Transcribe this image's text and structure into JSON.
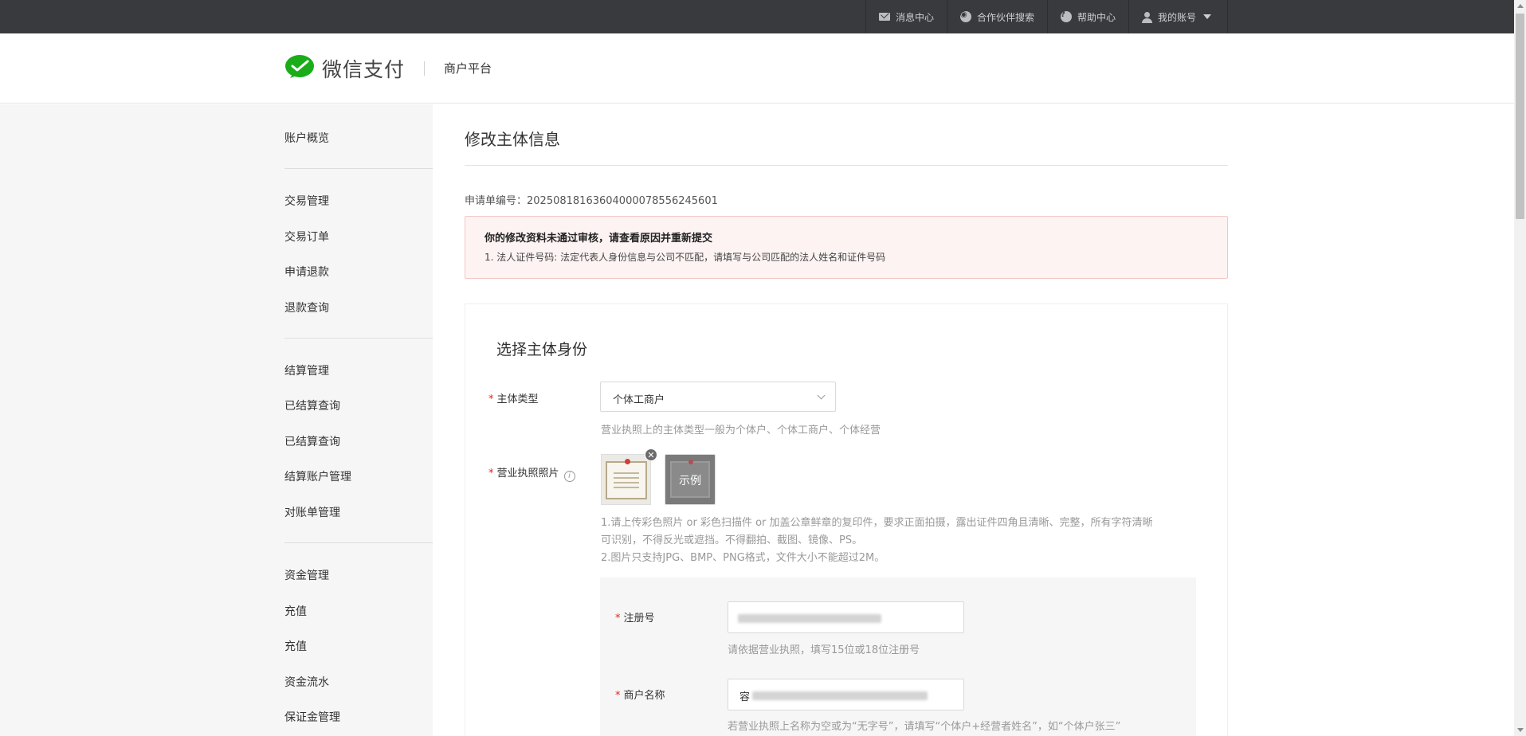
{
  "topbar": {
    "items": [
      {
        "label": "消息中心",
        "icon": "mail-icon"
      },
      {
        "label": "合作伙伴搜索",
        "icon": "partner-search-icon"
      },
      {
        "label": "帮助中心",
        "icon": "help-icon"
      },
      {
        "label": "我的账号",
        "icon": "user-icon"
      }
    ],
    "background": "#393a3e"
  },
  "header": {
    "brand": "微信支付",
    "platform": "商户平台",
    "brand_color": "#09bb07"
  },
  "sidebar": {
    "groups": [
      [
        "账户概览"
      ],
      [
        "交易管理",
        "交易订单",
        "申请退款",
        "退款查询"
      ],
      [
        "结算管理",
        "已结算查询",
        "已结算查询",
        "结算账户管理",
        "对账单管理"
      ],
      [
        "资金管理",
        "充值",
        "充值",
        "资金流水",
        "保证金管理"
      ]
    ]
  },
  "main": {
    "title": "修改主体信息",
    "application_label": "申请单编号：",
    "application_no": "2025081816360400007855624560​1",
    "alert": {
      "title": "你的修改资料未通过审核，请查看原因并重新提交",
      "message": "1. 法人证件号码: 法定代表人身份信息与公司不匹配，请填写与公司匹配的法人姓名和证件号码"
    },
    "section_title": "选择主体身份",
    "entity_type": {
      "label": "主体类型",
      "value": "个体工商户",
      "hint": "营业执照上的主体类型一般为个体户、个体工商户、个体经营"
    },
    "license_photo": {
      "label": "营业执照照片",
      "example_label": "示例",
      "note_1": "1.请上传彩色照片 or 彩色扫描件 or 加盖公章鲜章的复印件，要求正面拍摄，露出证件四角且清晰、完整，所有字符清晰",
      "note_1b": "可识别，不得反光或遮挡。不得翻拍、截图、镜像、PS。",
      "note_2": "2.图片只支持JPG、BMP、PNG格式，文件大小不能超过2M。"
    },
    "registration_no": {
      "label": "注册号",
      "hint": "请依据营业执照，填写15位或18位注册号"
    },
    "merchant_name": {
      "label": "商户名称",
      "value_prefix": "容",
      "hint": "若营业执照上名称为空或为“无字号”，请填写“个体户+经营者姓名”，如“个体户张三”"
    }
  }
}
